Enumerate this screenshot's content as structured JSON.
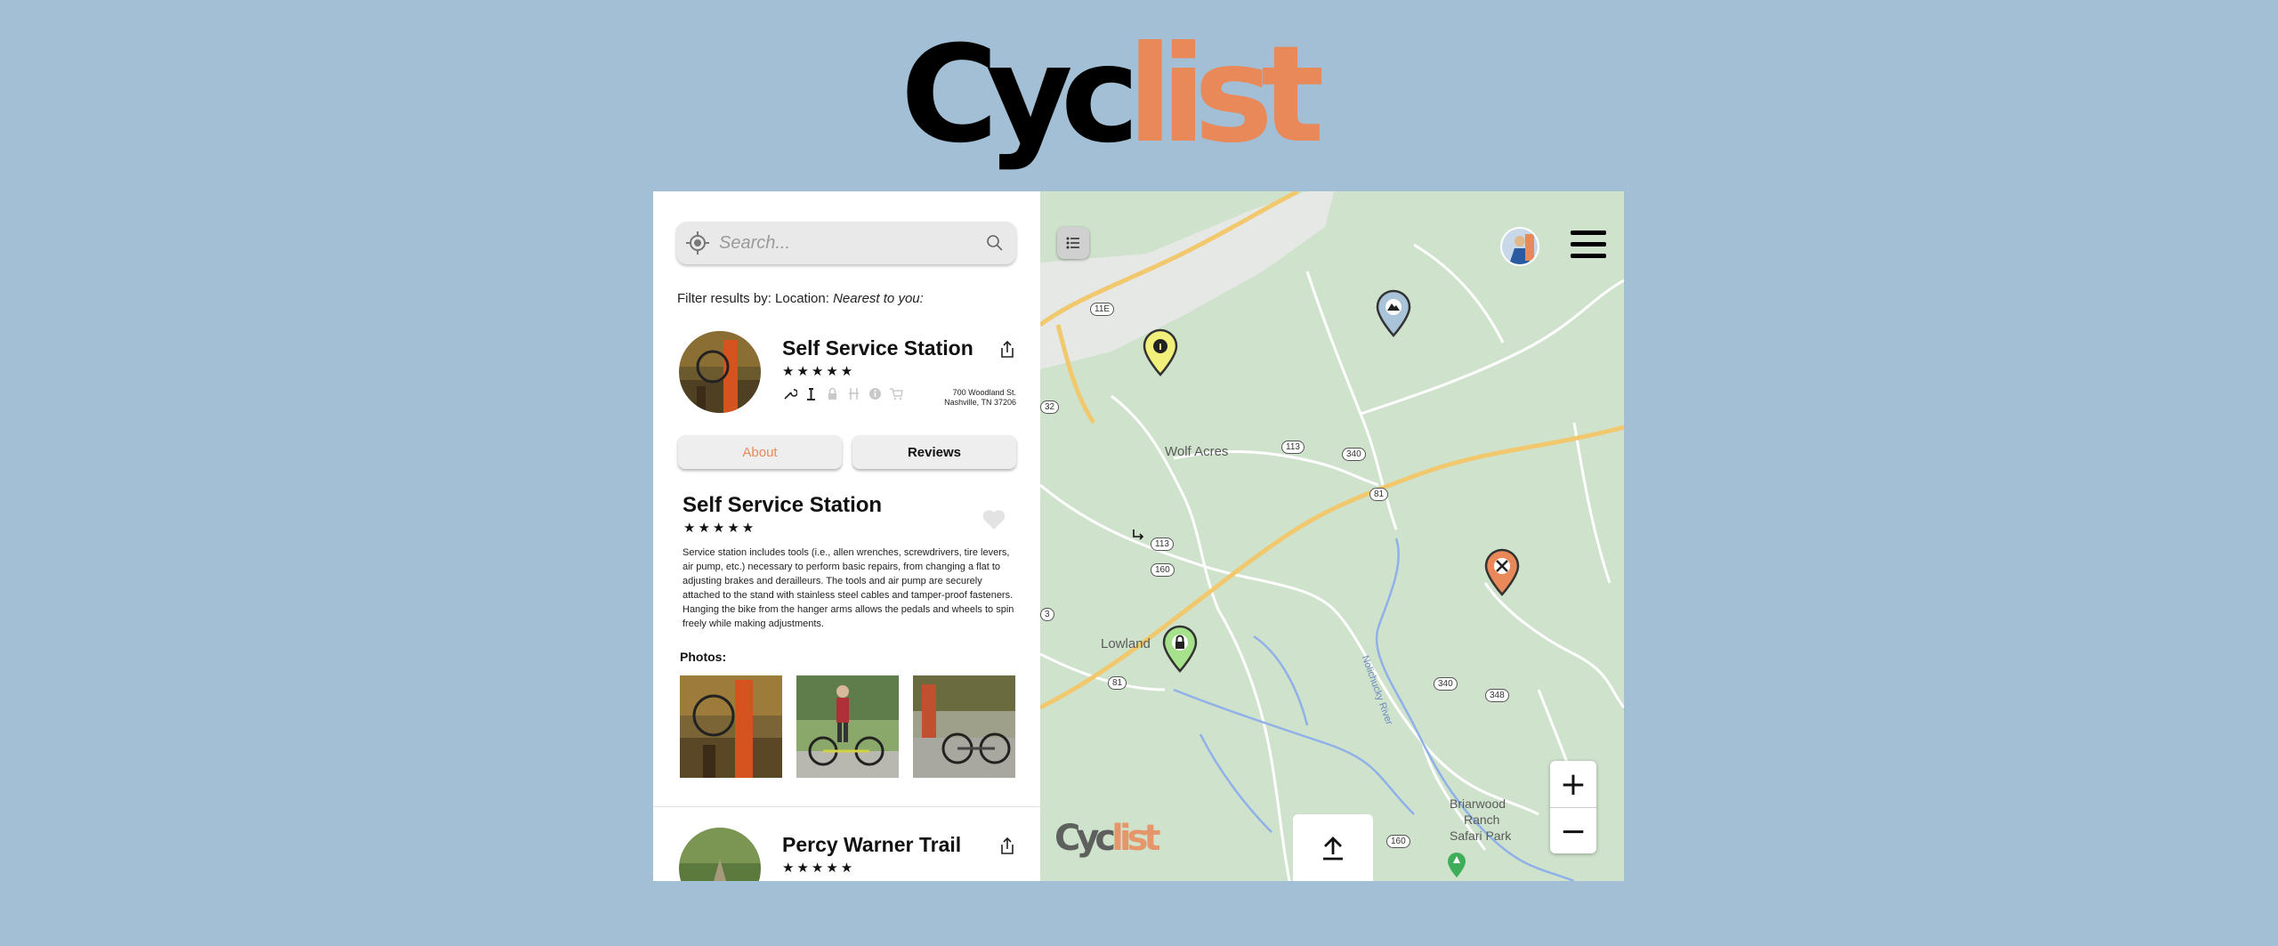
{
  "logo": {
    "part1": "Cyc",
    "part2": "list"
  },
  "search": {
    "placeholder": "Search..."
  },
  "filter": {
    "prefix": "Filter results by: Location:",
    "value": "Nearest to you:"
  },
  "results": [
    {
      "name": "Self Service Station",
      "stars": "★★★★★",
      "address_line1": "700 Woodland St.",
      "address_line2": "Nashville, TN 37206",
      "amenities": [
        "wrench-icon",
        "pump-icon",
        "lock-icon",
        "stand-icon",
        "info-icon",
        "cart-icon"
      ]
    },
    {
      "name": "Percy Warner Trail",
      "stars": "★★★★★"
    }
  ],
  "tabs": [
    {
      "label": "About",
      "active": true
    },
    {
      "label": "Reviews",
      "active": false
    }
  ],
  "detail": {
    "title": "Self Service Station",
    "stars": "★★★★★",
    "description": "Service station includes tools (i.e., allen wrenches, screwdrivers, tire levers, air pump, etc.) necessary to perform basic repairs, from changing a flat to adjusting brakes and derailleurs. The tools and air pump are securely attached to the stand with stainless steel cables and tamper-proof fasteners. Hanging the bike from the hanger arms allows the pedals and wheels to spin freely while making adjustments.",
    "photos_label": "Photos:"
  },
  "map": {
    "labels": {
      "wolf_acres": "Wolf Acres",
      "lowland": "Lowland",
      "briarwood": "Briarwood",
      "ranch": "Ranch",
      "safari": "Safari Park",
      "river": "Nolichucky River"
    },
    "shields": {
      "r11e": "11E",
      "r32": "32",
      "r113a": "113",
      "r340a": "340",
      "r81a": "81",
      "r113b": "113",
      "r160a": "160",
      "r3": "3",
      "r81b": "81",
      "r340b": "340",
      "r348": "348",
      "r160b": "160"
    },
    "zoom_in": "+",
    "zoom_out": "−",
    "mini_logo": {
      "part1": "Cyc",
      "part2": "list"
    }
  },
  "colors": {
    "background": "#a2bfd6",
    "accent": "#e9895a",
    "map_green": "#cfe3cc",
    "pin_yellow": "#f0f07a",
    "pin_blue": "#a9c3d9",
    "pin_orange": "#e9895a",
    "pin_green": "#a6e28c"
  }
}
